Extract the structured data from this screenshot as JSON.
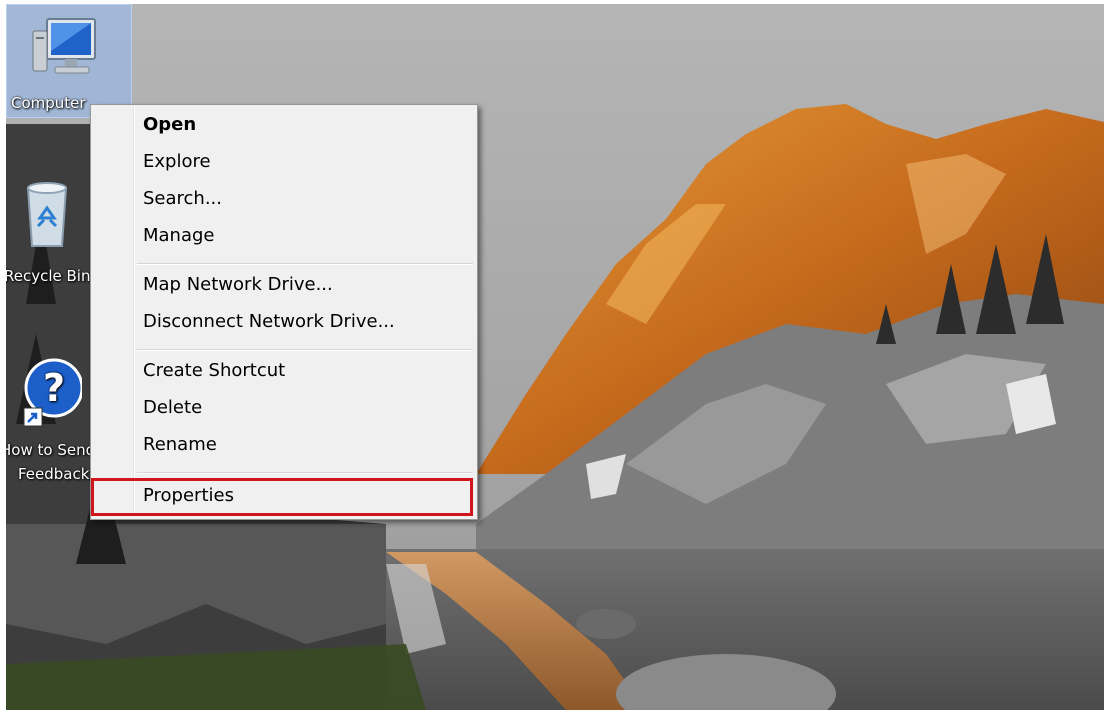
{
  "desktop": {
    "icons": {
      "computer": {
        "label": "Computer",
        "icon": "computer-icon"
      },
      "recycle": {
        "label": "Recycle Bin",
        "icon": "recycle-bin-icon"
      },
      "help": {
        "label_line1": "How to Send",
        "label_line2": "Feedback",
        "icon": "help-shortcut-icon"
      }
    }
  },
  "context_menu": {
    "items": [
      {
        "label": "Open",
        "bold": true
      },
      {
        "label": "Explore"
      },
      {
        "label": "Search..."
      },
      {
        "label": "Manage"
      },
      {
        "label": "Map Network Drive..."
      },
      {
        "label": "Disconnect Network Drive..."
      },
      {
        "label": "Create Shortcut"
      },
      {
        "label": "Delete"
      },
      {
        "label": "Rename"
      },
      {
        "label": "Properties",
        "highlighted": true
      }
    ]
  },
  "colors": {
    "highlight_border": "#d0161c",
    "menu_bg": "#f0f0f0"
  }
}
